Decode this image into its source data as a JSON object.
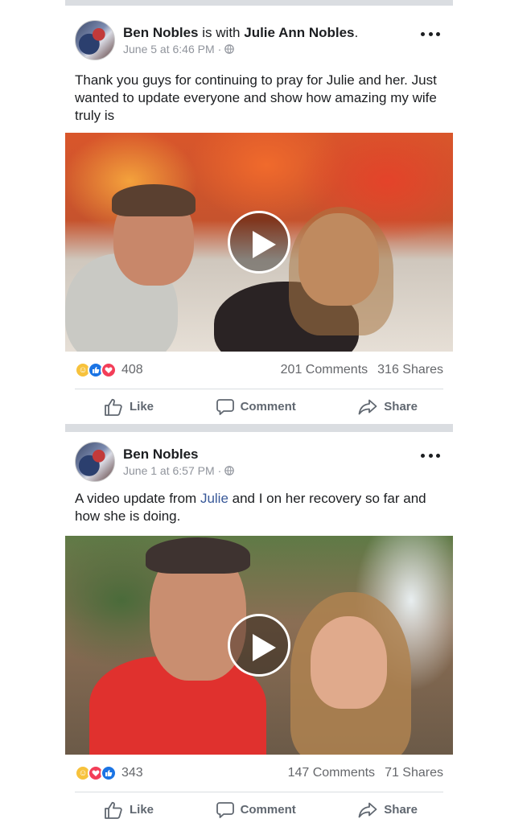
{
  "posts": [
    {
      "author": "Ben Nobles",
      "with_text": "is with",
      "tagged": "Julie Ann Nobles",
      "tagged_suffix": ".",
      "timestamp": "June 5 at 6:46 PM",
      "text_before_link": "Thank you guys for continuing to pray for Julie and her. Just wanted to update everyone and show how amazing my wife truly is",
      "link_text": "",
      "text_after_link": "",
      "reaction_count": "408",
      "comments": "201 Comments",
      "shares": "316 Shares"
    },
    {
      "author": "Ben Nobles",
      "with_text": "",
      "tagged": "",
      "tagged_suffix": "",
      "timestamp": "June 1 at 6:57 PM",
      "text_before_link": "A video update from ",
      "link_text": "Julie",
      "text_after_link": " and I on her recovery so far and how she is doing.",
      "reaction_count": "343",
      "comments": "147 Comments",
      "shares": "71 Shares"
    }
  ],
  "actions": {
    "like": "Like",
    "comment": "Comment",
    "share": "Share"
  },
  "meta_separator": "·",
  "colors": {
    "accent": "#385898",
    "like_blue": "#1b74e4",
    "love_red": "#f33e58",
    "care_yellow": "#f7c23c",
    "muted": "#65676b"
  },
  "icons": [
    "globe-icon",
    "more-options-icon",
    "play-icon",
    "like-thumb-icon",
    "comment-bubble-icon",
    "share-arrow-icon"
  ]
}
